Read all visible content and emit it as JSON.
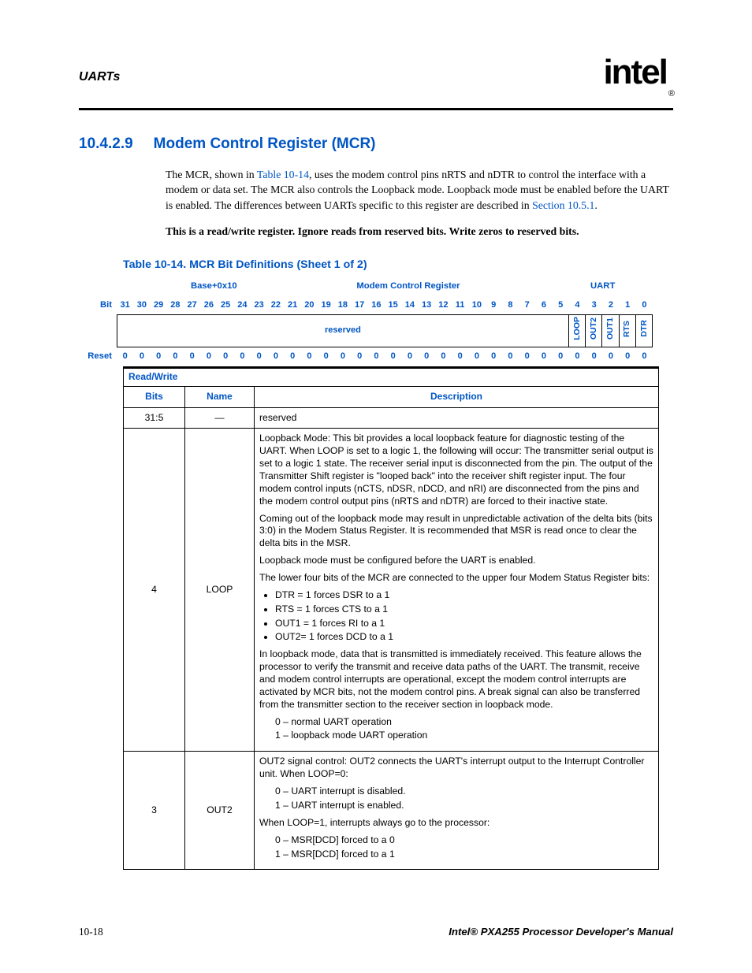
{
  "header": {
    "section_name": "UARTs",
    "logo_text": "intel",
    "logo_reg": "®"
  },
  "section": {
    "number": "10.4.2.9",
    "title": "Modem Control Register (MCR)"
  },
  "paragraphs": {
    "p1_a": "The MCR, shown in ",
    "p1_link1": "Table 10-14",
    "p1_b": ", uses the modem control pins nRTS and nDTR to control the interface with a modem or data set. The MCR also controls the Loopback mode. Loopback mode must be enabled before the UART is enabled. The differences between UARTs specific to this register are described in ",
    "p1_link2": "Section 10.5.1",
    "p1_c": ".",
    "p2": "This is a read/write register. Ignore reads from reserved bits. Write zeros to reserved bits."
  },
  "table_caption": "Table 10-14. MCR Bit Definitions (Sheet 1 of 2)",
  "register": {
    "addr": "Base+0x10",
    "name": "Modem Control Register",
    "block": "UART",
    "bit_label": "Bit",
    "reset_label": "Reset",
    "bits": [
      "31",
      "30",
      "29",
      "28",
      "27",
      "26",
      "25",
      "24",
      "23",
      "22",
      "21",
      "20",
      "19",
      "18",
      "17",
      "16",
      "15",
      "14",
      "13",
      "12",
      "11",
      "10",
      "9",
      "8",
      "7",
      "6",
      "5",
      "4",
      "3",
      "2",
      "1",
      "0"
    ],
    "fields": {
      "reserved": "reserved",
      "b4": "LOOP",
      "b3": "OUT2",
      "b2": "OUT1",
      "b1": "RTS",
      "b0": "DTR"
    },
    "reset_values": [
      "0",
      "0",
      "0",
      "0",
      "0",
      "0",
      "0",
      "0",
      "0",
      "0",
      "0",
      "0",
      "0",
      "0",
      "0",
      "0",
      "0",
      "0",
      "0",
      "0",
      "0",
      "0",
      "0",
      "0",
      "0",
      "0",
      "0",
      "0",
      "0",
      "0",
      "0",
      "0"
    ]
  },
  "def_table": {
    "rw": "Read/Write",
    "headers": {
      "bits": "Bits",
      "name": "Name",
      "desc": "Description"
    },
    "rows": [
      {
        "bits": "31:5",
        "name": "—",
        "desc_plain": "reserved"
      },
      {
        "bits": "4",
        "name": "LOOP",
        "desc": {
          "p1": "Loopback Mode: This bit provides a local loopback feature for diagnostic testing of the UART. When LOOP is set to a logic 1, the following will occur: The transmitter serial output is set to a logic 1 state. The receiver serial input is disconnected from the pin. The output of the Transmitter Shift register is \"looped back\" into the receiver shift register input. The four modem control inputs (nCTS, nDSR, nDCD, and nRI) are disconnected from the pins and the modem control output pins (nRTS and nDTR) are forced to their inactive state.",
          "p2": "Coming out of the loopback mode may result in unpredictable activation of the delta bits (bits 3:0) in the Modem Status Register. It is recommended that MSR is read once to clear the delta bits in the MSR.",
          "p3": "Loopback mode must be configured before the UART is enabled.",
          "p4": "The lower four bits of the MCR are connected to the upper four Modem Status Register bits:",
          "list": [
            "DTR = 1 forces DSR to a 1",
            "RTS = 1 forces CTS to a 1",
            "OUT1 = 1 forces RI to a 1",
            "OUT2= 1 forces DCD to a 1"
          ],
          "p5": "In loopback mode, data that is transmitted is immediately received. This feature allows the processor to verify the transmit and receive data paths of the UART. The transmit, receive and modem control interrupts are operational, except the modem control interrupts are activated by MCR bits, not the modem control pins. A break signal can also be transferred from the transmitter section to the receiver section in loopback mode.",
          "vals": [
            "0 –  normal UART operation",
            "1 –  loopback mode UART operation"
          ]
        }
      },
      {
        "bits": "3",
        "name": "OUT2",
        "desc": {
          "p1": "OUT2 signal control: OUT2 connects the UART's interrupt output to the Interrupt Controller unit. When LOOP=0:",
          "vals1": [
            "0 –  UART interrupt is disabled.",
            "1 –  UART interrupt is enabled."
          ],
          "p2": "When LOOP=1, interrupts always go to the processor:",
          "vals2": [
            "0 –  MSR[DCD] forced to a 0",
            "1 –  MSR[DCD] forced to a 1"
          ]
        }
      }
    ]
  },
  "footer": {
    "page": "10-18",
    "doc": "Intel® PXA255 Processor Developer's Manual"
  }
}
